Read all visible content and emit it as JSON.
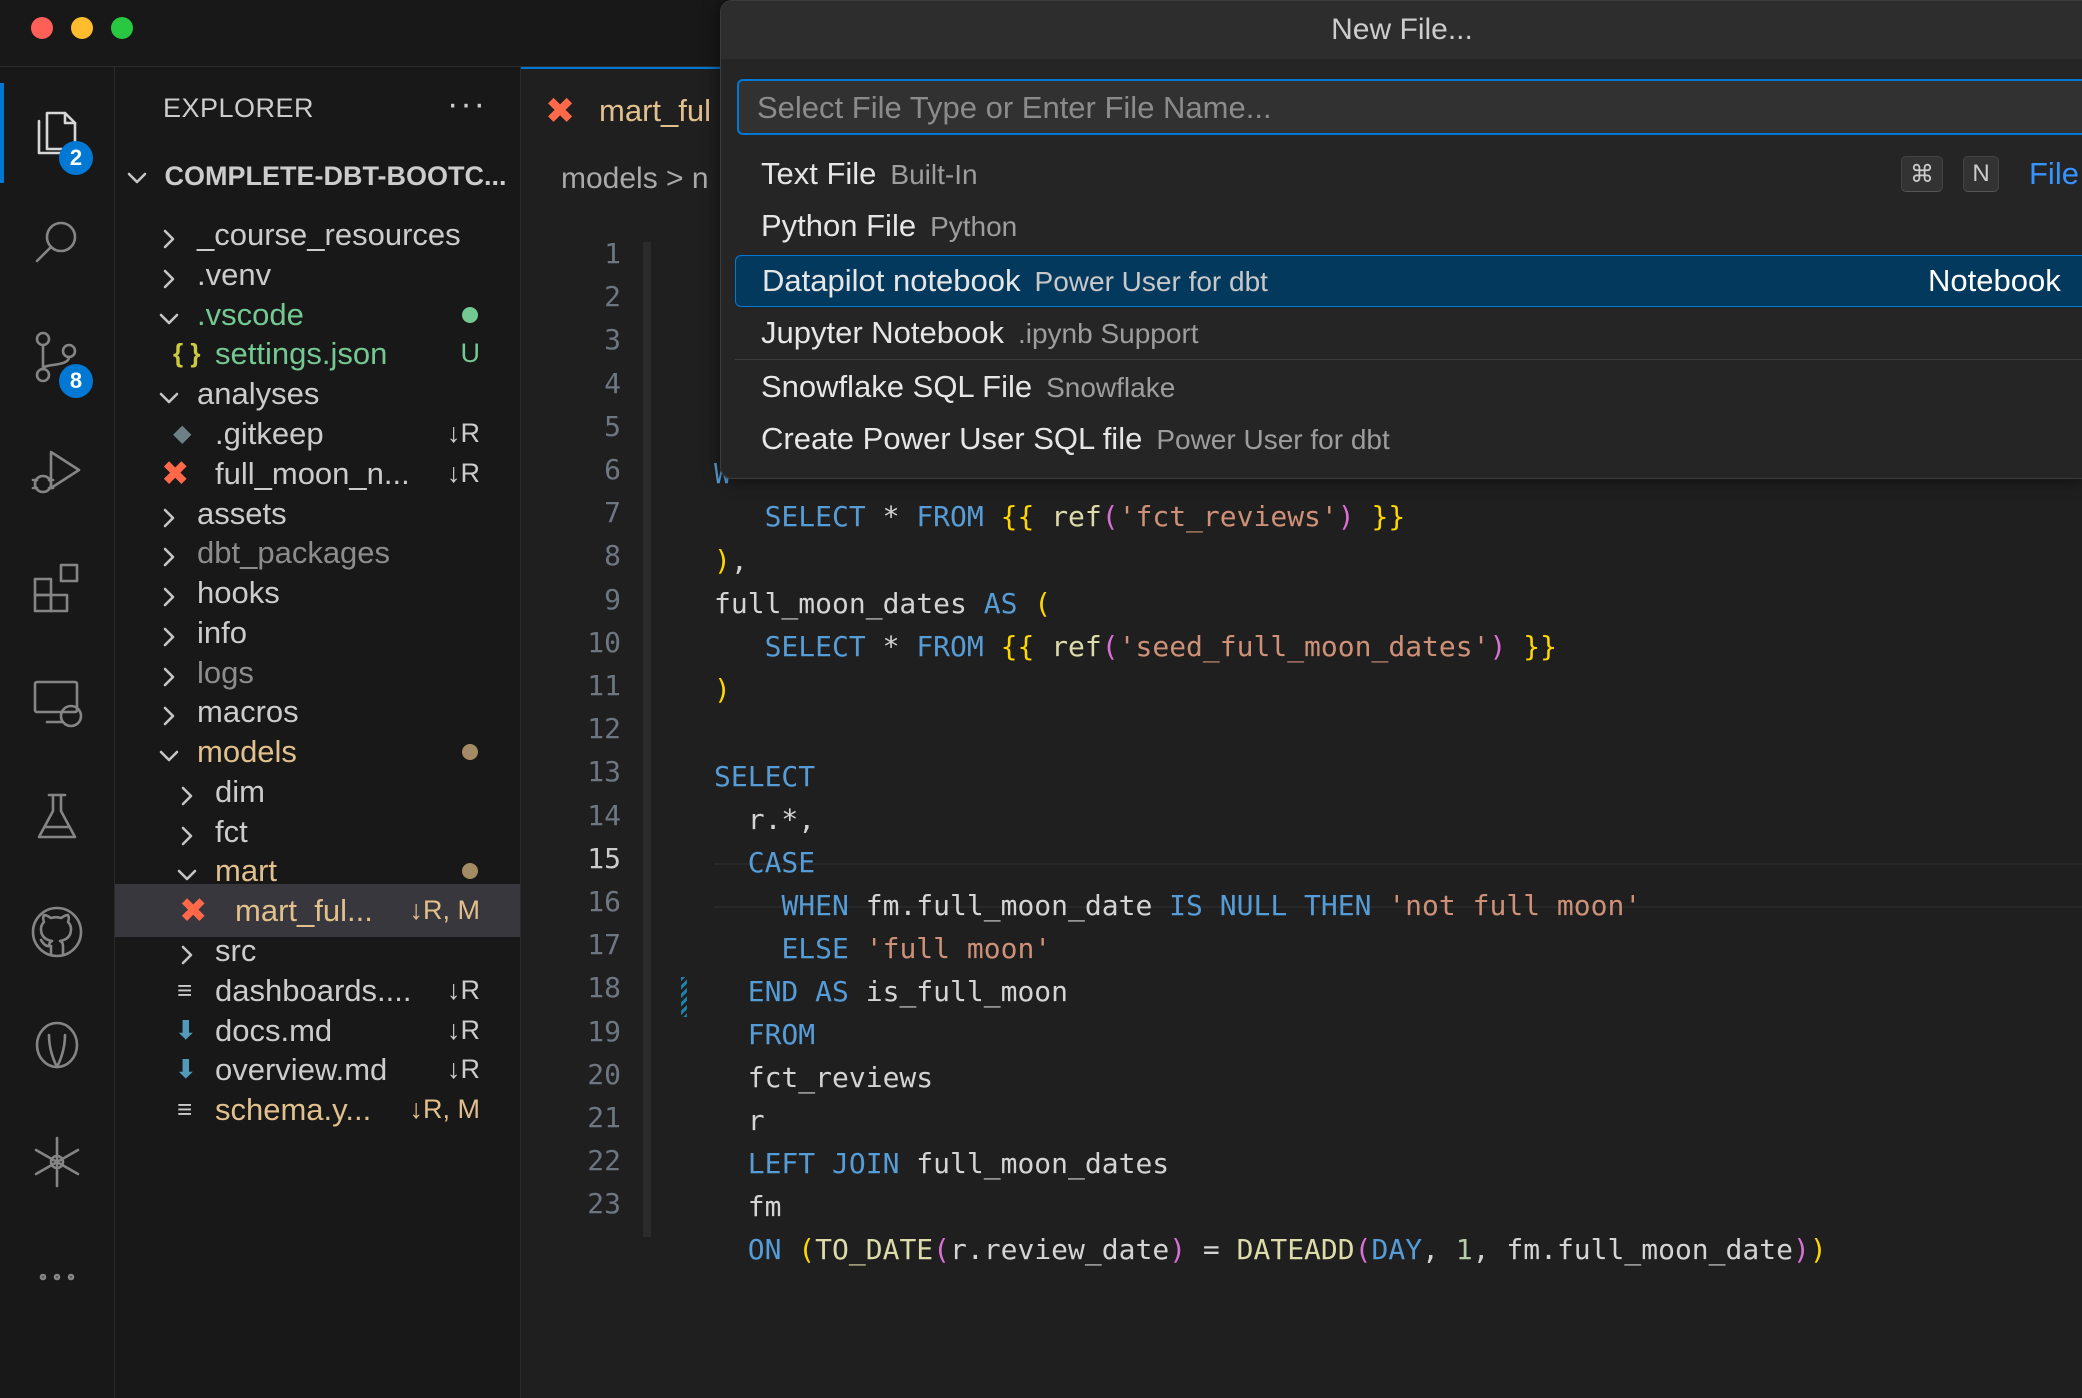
{
  "activity_badges": {
    "explorer": "2",
    "source_control": "8"
  },
  "explorer": {
    "title": "EXPLORER",
    "more": "···",
    "root": "COMPLETE-DBT-BOOTC...",
    "items": [
      {
        "label": "_course_resources",
        "status": ""
      },
      {
        "label": ".venv",
        "status": ""
      },
      {
        "label": ".vscode",
        "status": ""
      },
      {
        "label": "settings.json",
        "status": "U",
        "icon": "{ }"
      },
      {
        "label": "analyses",
        "status": ""
      },
      {
        "label": ".gitkeep",
        "status": "↓R"
      },
      {
        "label": "full_moon_n...",
        "status": "↓R"
      },
      {
        "label": "assets",
        "status": ""
      },
      {
        "label": "dbt_packages",
        "status": ""
      },
      {
        "label": "hooks",
        "status": ""
      },
      {
        "label": "info",
        "status": ""
      },
      {
        "label": "logs",
        "status": ""
      },
      {
        "label": "macros",
        "status": ""
      },
      {
        "label": "models",
        "status": ""
      },
      {
        "label": "dim",
        "status": ""
      },
      {
        "label": "fct",
        "status": ""
      },
      {
        "label": "mart",
        "status": ""
      },
      {
        "label": "mart_ful...",
        "status": "↓R, M"
      },
      {
        "label": "src",
        "status": ""
      },
      {
        "label": "dashboards....",
        "status": "↓R"
      },
      {
        "label": "docs.md",
        "status": "↓R"
      },
      {
        "label": "overview.md",
        "status": "↓R"
      },
      {
        "label": "schema.y...",
        "status": "↓R, M"
      }
    ]
  },
  "editor": {
    "tab_label": "mart_ful",
    "breadcrumb": "models > n",
    "line_numbers": [
      "1",
      "2",
      "3",
      "4",
      "5",
      "6",
      "7",
      "8",
      "9",
      "10",
      "11",
      "12",
      "13",
      "14",
      "15",
      "16",
      "17",
      "18",
      "19",
      "20",
      "21",
      "22",
      "23"
    ],
    "current_line": "15"
  },
  "quick_pick": {
    "title": "New File...",
    "placeholder": "Select File Type or Enter File Name...",
    "items": [
      {
        "label": "Text File",
        "description": "Built-In",
        "key1": "⌘",
        "key2": "N",
        "right": "File"
      },
      {
        "label": "Python File",
        "description": "Python"
      },
      {
        "label": "Datapilot notebook",
        "description": "Power User for dbt",
        "right": "Notebook"
      },
      {
        "label": "Jupyter Notebook",
        "description": ".ipynb Support"
      },
      {
        "label": "Snowflake SQL File",
        "description": "Snowflake"
      },
      {
        "label": "Create Power User SQL file",
        "description": "Power User for dbt"
      }
    ]
  },
  "colors": {
    "accent": "#0078d4",
    "git_added": "#73c991",
    "git_modified": "#e2c08d",
    "dbt_orange": "#ff694a"
  }
}
